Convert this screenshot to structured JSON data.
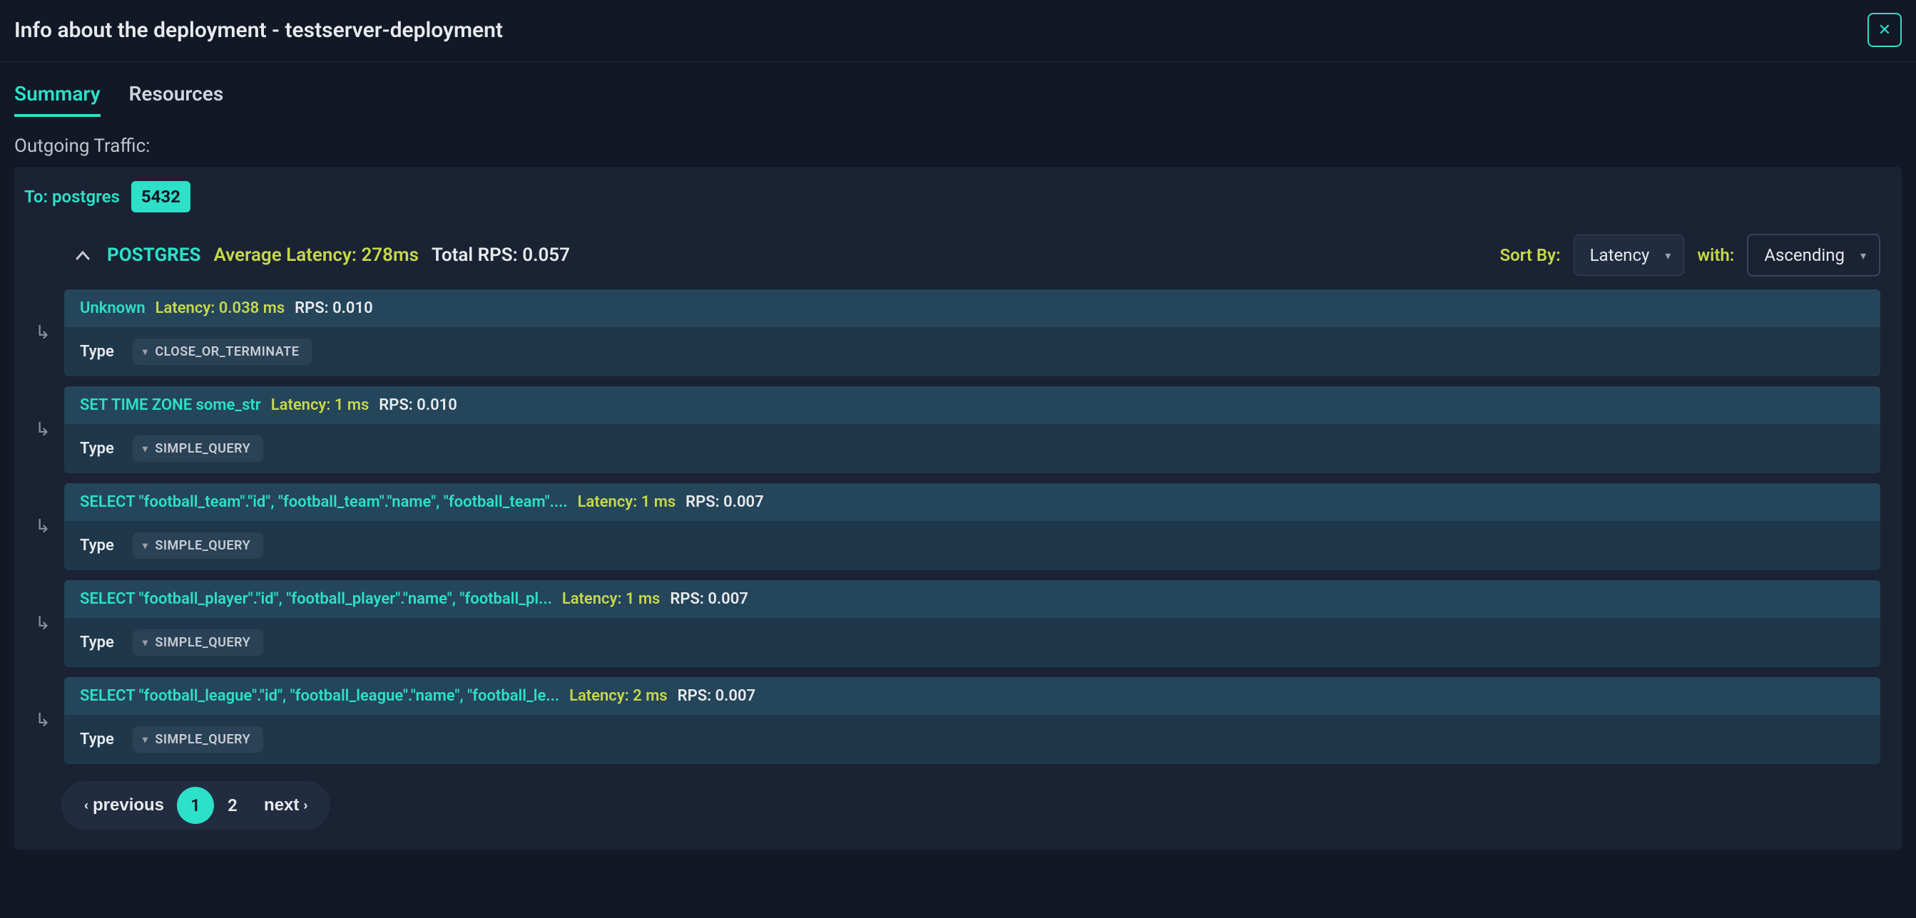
{
  "header": {
    "title": "Info about the deployment - testserver-deployment"
  },
  "tabs": {
    "summary": "Summary",
    "resources": "Resources"
  },
  "section": {
    "outgoing_label": "Outgoing Traffic:"
  },
  "destination": {
    "to_label": "To: postgres",
    "port": "5432"
  },
  "summary": {
    "protocol": "POSTGRES",
    "avg_latency": "Average Latency: 278ms",
    "total_rps": "Total RPS: 0.057"
  },
  "sort": {
    "by_label": "Sort By:",
    "by_value": "Latency",
    "with_label": "with:",
    "with_value": "Ascending"
  },
  "type_label": "Type",
  "queries": [
    {
      "name": "Unknown",
      "latency": "Latency: 0.038 ms",
      "rps": "RPS: 0.010",
      "type": "CLOSE_OR_TERMINATE"
    },
    {
      "name": "SET TIME ZONE some_str",
      "latency": "Latency: 1 ms",
      "rps": "RPS: 0.010",
      "type": "SIMPLE_QUERY"
    },
    {
      "name": "SELECT \"football_team\".\"id\", \"football_team\".\"name\", \"football_team\"....",
      "latency": "Latency: 1 ms",
      "rps": "RPS: 0.007",
      "type": "SIMPLE_QUERY"
    },
    {
      "name": "SELECT \"football_player\".\"id\", \"football_player\".\"name\", \"football_pl...",
      "latency": "Latency: 1 ms",
      "rps": "RPS: 0.007",
      "type": "SIMPLE_QUERY"
    },
    {
      "name": "SELECT \"football_league\".\"id\", \"football_league\".\"name\", \"football_le...",
      "latency": "Latency: 2 ms",
      "rps": "RPS: 0.007",
      "type": "SIMPLE_QUERY"
    }
  ],
  "pagination": {
    "prev": "previous",
    "next": "next",
    "pages": [
      "1",
      "2"
    ],
    "active": "1"
  }
}
